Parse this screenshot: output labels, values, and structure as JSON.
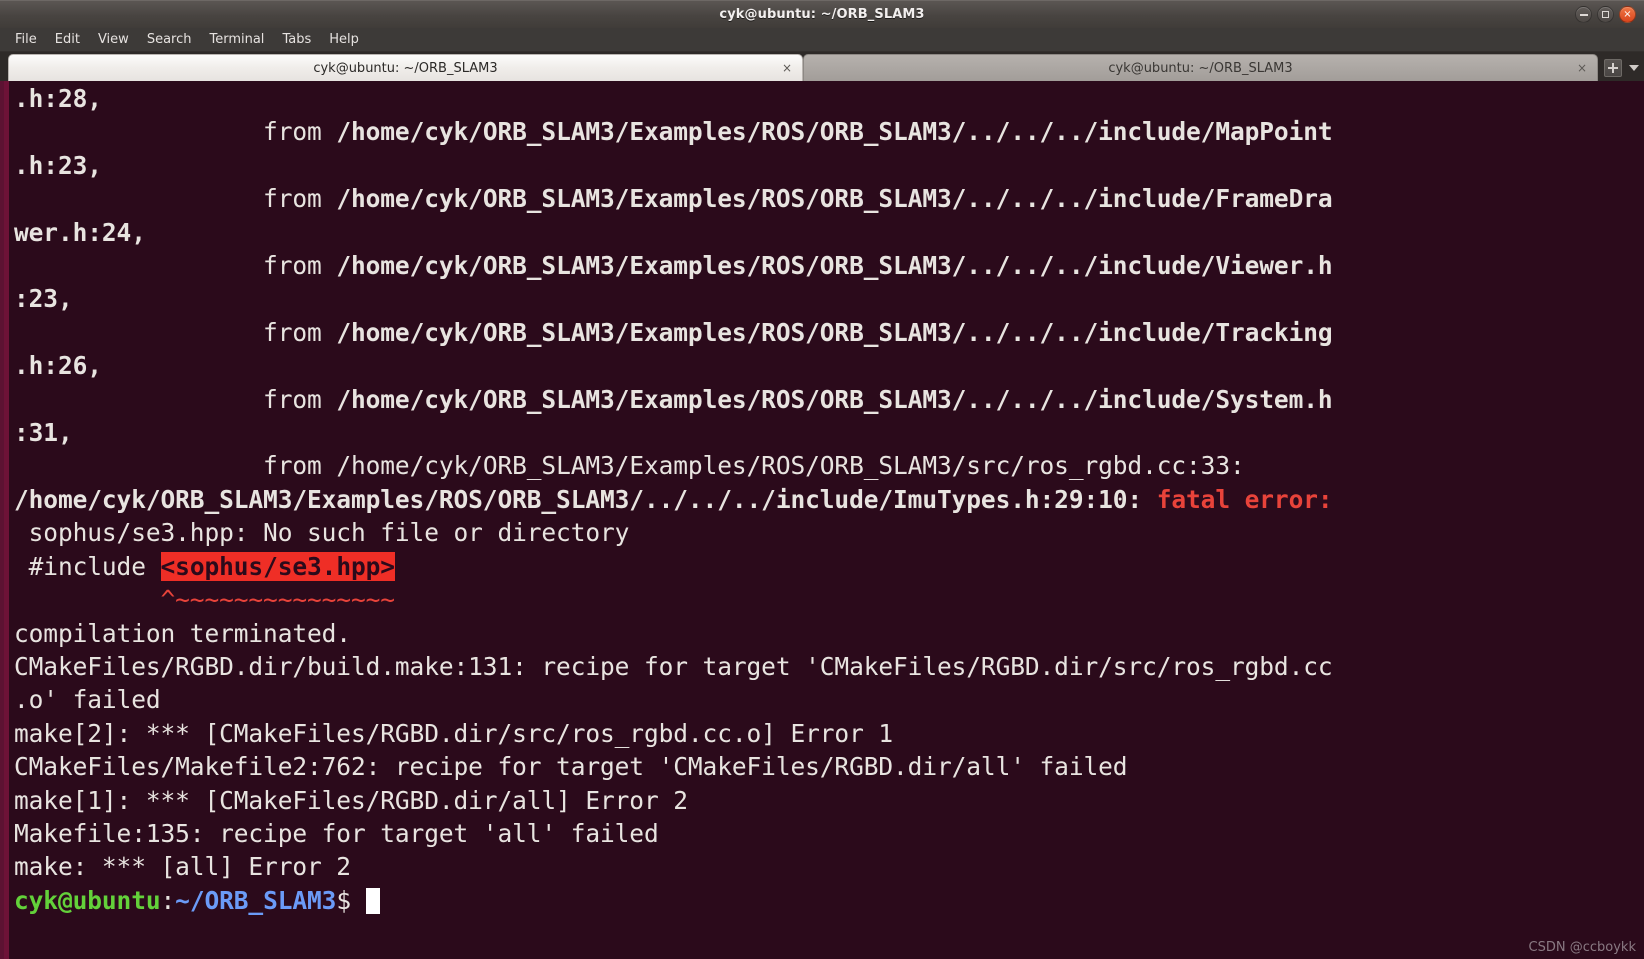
{
  "window": {
    "title": "cyk@ubuntu: ~/ORB_SLAM3",
    "controls": {
      "minimize": "minimize",
      "maximize": "maximize",
      "close": "×"
    }
  },
  "menubar": {
    "items": [
      {
        "label": "File"
      },
      {
        "label": "Edit"
      },
      {
        "label": "View"
      },
      {
        "label": "Search"
      },
      {
        "label": "Terminal"
      },
      {
        "label": "Tabs"
      },
      {
        "label": "Help"
      }
    ]
  },
  "tabbar": {
    "tabs": [
      {
        "label": "cyk@ubuntu: ~/ORB_SLAM3",
        "close": "×",
        "active": true
      },
      {
        "label": "cyk@ubuntu: ~/ORB_SLAM3",
        "close": "×",
        "active": false
      }
    ],
    "new_tab_label": "+",
    "dropdown_label": "▼"
  },
  "terminal": {
    "colors": {
      "background": "#2b0a1b",
      "foreground": "#e8e4e0",
      "error_red": "#e8433a",
      "highlight_red": "#ef2e26",
      "prompt_user": "#63d13a",
      "prompt_path": "#6b9bf7",
      "left_stripe": "#6d1237"
    },
    "lines": {
      "l01": ".h:28,",
      "l02_from": "                 from ",
      "l02_path": "/home/cyk/ORB_SLAM3/Examples/ROS/ORB_SLAM3/../../../include/MapPoint",
      "l03": ".h:23,",
      "l04_from": "                 from ",
      "l04_path": "/home/cyk/ORB_SLAM3/Examples/ROS/ORB_SLAM3/../../../include/FrameDra",
      "l05": "wer.h:24,",
      "l06_from": "                 from ",
      "l06_path": "/home/cyk/ORB_SLAM3/Examples/ROS/ORB_SLAM3/../../../include/Viewer.h",
      "l07": ":23,",
      "l08_from": "                 from ",
      "l08_path": "/home/cyk/ORB_SLAM3/Examples/ROS/ORB_SLAM3/../../../include/Tracking",
      "l09": ".h:26,",
      "l10_from": "                 from ",
      "l10_path": "/home/cyk/ORB_SLAM3/Examples/ROS/ORB_SLAM3/../../../include/System.h",
      "l11": ":31,",
      "l12_from": "                 from ",
      "l12_path": "/home/cyk/ORB_SLAM3/Examples/ROS/ORB_SLAM3/src/ros_rgbd.cc:33:",
      "l13_path": "/home/cyk/ORB_SLAM3/Examples/ROS/ORB_SLAM3/../../../include/ImuTypes.h:29:10: ",
      "l13_err": "fatal error:",
      "l14": " sophus/se3.hpp: No such file or directory",
      "l15_pre": " #include ",
      "l15_hl": "<sophus/se3.hpp>",
      "l16": "          ^~~~~~~~~~~~~~~~",
      "l17": "compilation terminated.",
      "l18": "CMakeFiles/RGBD.dir/build.make:131: recipe for target 'CMakeFiles/RGBD.dir/src/ros_rgbd.cc",
      "l19": ".o' failed",
      "l20": "make[2]: *** [CMakeFiles/RGBD.dir/src/ros_rgbd.cc.o] Error 1",
      "l21": "CMakeFiles/Makefile2:762: recipe for target 'CMakeFiles/RGBD.dir/all' failed",
      "l22": "make[1]: *** [CMakeFiles/RGBD.dir/all] Error 2",
      "l23": "Makefile:135: recipe for target 'all' failed",
      "l24": "make: *** [all] Error 2"
    },
    "prompt": {
      "user": "cyk@ubuntu",
      "colon": ":",
      "path": "~/ORB_SLAM3",
      "symbol": "$ "
    }
  },
  "watermark": "CSDN @ccboykk"
}
